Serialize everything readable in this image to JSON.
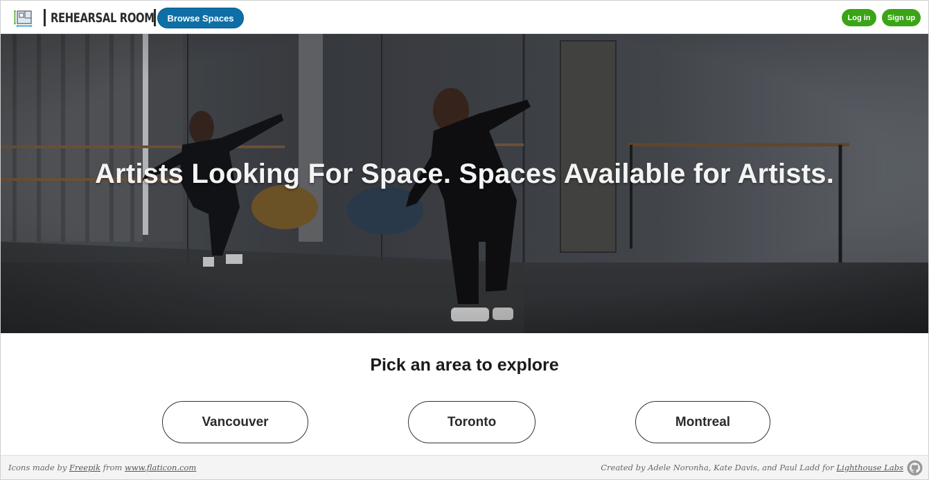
{
  "header": {
    "logo_icon": "floor-plan-icon",
    "brand": "REHEARSAL ROOM",
    "browse_label": "Browse Spaces",
    "login_label": "Log in",
    "signup_label": "Sign up"
  },
  "hero": {
    "title": "Artists Looking For Space. Spaces Available for Artists."
  },
  "explore": {
    "heading": "Pick an area to explore",
    "areas": [
      "Vancouver",
      "Toronto",
      "Montreal"
    ]
  },
  "footer": {
    "left_prefix": "Icons made by ",
    "left_link1": "Freepik",
    "left_mid": " from ",
    "left_link2": "www.flaticon.com",
    "right_prefix": "Created by Adele Noronha, Kate Davis, and Paul Ladd for ",
    "right_link": "Lighthouse Labs",
    "github_icon": "github-icon"
  },
  "colors": {
    "primary_blue": "#0e6fa6",
    "accent_green": "#3aa416"
  }
}
